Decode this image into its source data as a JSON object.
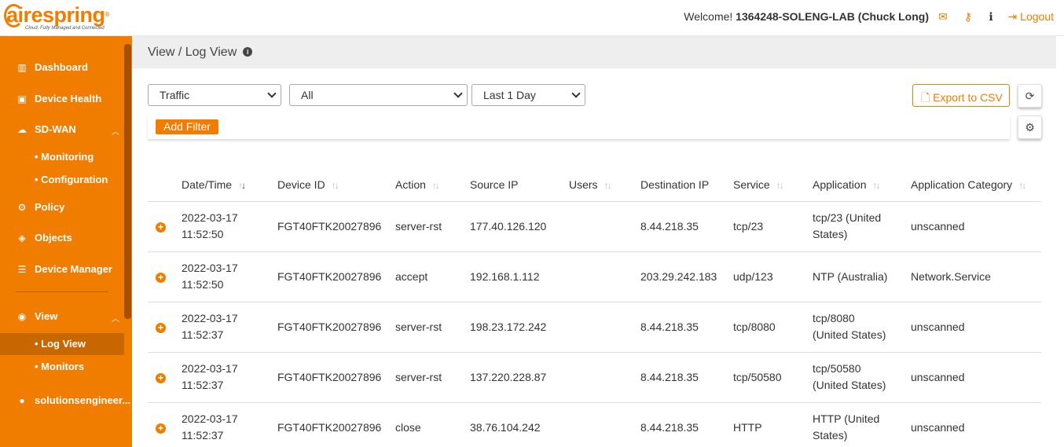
{
  "brand": {
    "name": "airespring",
    "tagline": "Cloud, Fully Managed and Connected",
    "color": "#f07c00"
  },
  "header": {
    "welcome_label": "Welcome!",
    "user": "1364248-SOLENG-LAB (Chuck Long)",
    "icons": [
      "envelope-icon",
      "key-icon",
      "info-icon"
    ],
    "logout_label": "Logout"
  },
  "sidebar": {
    "items": [
      {
        "label": "Dashboard",
        "icon": "bar-chart-icon"
      },
      {
        "label": "Device Health",
        "icon": "briefcase-icon"
      },
      {
        "label": "SD-WAN",
        "icon": "cloud-icon"
      },
      {
        "label": "Monitoring"
      },
      {
        "label": "Configuration"
      },
      {
        "label": "Policy",
        "icon": "cogs-icon"
      },
      {
        "label": "Objects",
        "icon": "cube-icon"
      },
      {
        "label": "Device Manager",
        "icon": "server-icon"
      },
      {
        "label": "View",
        "icon": "eye-icon"
      },
      {
        "label": "Log View"
      },
      {
        "label": "Monitors"
      },
      {
        "label": "solutionsengineer..."
      }
    ]
  },
  "breadcrumb": "View / Log View",
  "filters": {
    "log_type": "Traffic",
    "scope": "All",
    "time_range": "Last 1 Day",
    "export_label": "Export to CSV",
    "add_filter_label": "Add Filter"
  },
  "table": {
    "columns": [
      "Date/Time",
      "Device ID",
      "Action",
      "Source IP",
      "Users",
      "Destination IP",
      "Service",
      "Application",
      "Application Category"
    ],
    "rows": [
      {
        "date": "2022-03-17",
        "time": "11:52:50",
        "device": "FGT40FTK20027896",
        "action": "server-rst",
        "src": "177.40.126.120",
        "users": "",
        "dst": "8.44.218.35",
        "service": "tcp/23",
        "app1": "tcp/23 (United",
        "app2": "States)",
        "category": "unscanned"
      },
      {
        "date": "2022-03-17",
        "time": "11:52:50",
        "device": "FGT40FTK20027896",
        "action": "accept",
        "src": "192.168.1.112",
        "users": "",
        "dst": "203.29.242.183",
        "service": "udp/123",
        "app1": "NTP (Australia)",
        "app2": "",
        "category": "Network.Service"
      },
      {
        "date": "2022-03-17",
        "time": "11:52:37",
        "device": "FGT40FTK20027896",
        "action": "server-rst",
        "src": "198.23.172.242",
        "users": "",
        "dst": "8.44.218.35",
        "service": "tcp/8080",
        "app1": "tcp/8080",
        "app2": "(United States)",
        "category": "unscanned"
      },
      {
        "date": "2022-03-17",
        "time": "11:52:37",
        "device": "FGT40FTK20027896",
        "action": "server-rst",
        "src": "137.220.228.87",
        "users": "",
        "dst": "8.44.218.35",
        "service": "tcp/50580",
        "app1": "tcp/50580",
        "app2": "(United States)",
        "category": "unscanned"
      },
      {
        "date": "2022-03-17",
        "time": "11:52:37",
        "device": "FGT40FTK20027896",
        "action": "close",
        "src": "38.76.104.242",
        "users": "",
        "dst": "8.44.218.35",
        "service": "HTTP",
        "app1": "HTTP (United",
        "app2": "States)",
        "category": "unscanned"
      }
    ]
  }
}
